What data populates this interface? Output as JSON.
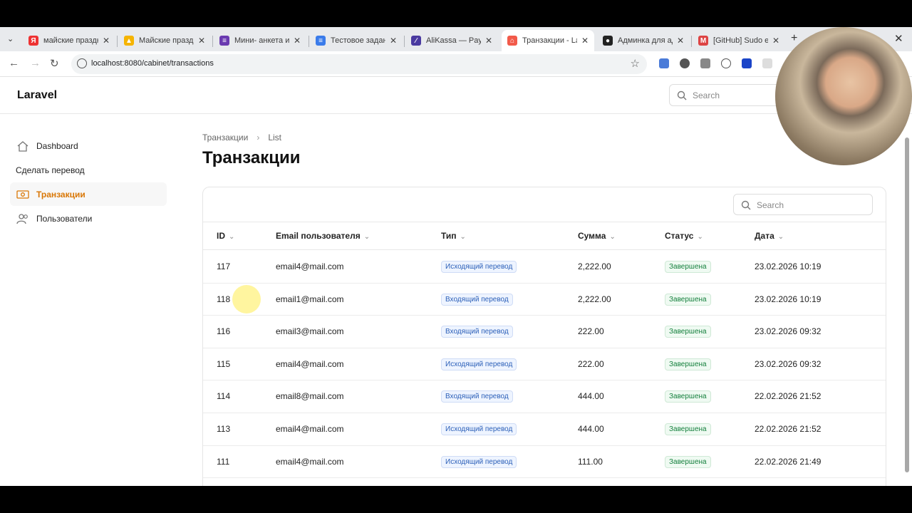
{
  "tabs": [
    {
      "title": "майские праздни",
      "fav_color": "#e33",
      "fav_glyph": "Я",
      "active": false
    },
    {
      "title": "Майские праздни",
      "fav_color": "#f5b400",
      "fav_glyph": "▲",
      "active": false
    },
    {
      "title": "Мини- анкета и и",
      "fav_color": "#6a3ab0",
      "fav_glyph": "≡",
      "active": false
    },
    {
      "title": "Тестовое задание",
      "fav_color": "#3a7bea",
      "fav_glyph": "≡",
      "active": false
    },
    {
      "title": "AliKassa — Payme",
      "fav_color": "#4a3aa0",
      "fav_glyph": "∕",
      "active": false
    },
    {
      "title": "Транзакции - Lar",
      "fav_color": "#f25a4a",
      "fav_glyph": "⌂",
      "active": true
    },
    {
      "title": "Админка для адм",
      "fav_color": "#222",
      "fav_glyph": "●",
      "active": false
    },
    {
      "title": "[GitHub] Sudo em",
      "fav_color": "#d44",
      "fav_glyph": "M",
      "active": false
    }
  ],
  "address": {
    "url": "localhost:8080/cabinet/transactions"
  },
  "app": {
    "brand": "Laravel",
    "search_placeholder": "Search"
  },
  "sidebar": {
    "items": [
      {
        "label": "Dashboard",
        "icon": "home-icon"
      },
      {
        "label": "Сделать перевод",
        "icon": ""
      },
      {
        "label": "Транзакции",
        "icon": "money-icon",
        "active": true
      },
      {
        "label": "Пользователи",
        "icon": "users-icon"
      }
    ]
  },
  "page": {
    "breadcrumb": [
      "Транзакции",
      "List"
    ],
    "title": "Транзакции"
  },
  "table": {
    "search_placeholder": "Search",
    "columns": [
      "ID",
      "Email пользователя",
      "Тип",
      "Сумма",
      "Статус",
      "Дата"
    ],
    "rows": [
      {
        "id": "117",
        "email": "email4@mail.com",
        "type": "Исходящий перевод",
        "amount": "2,222.00",
        "status": "Завершена",
        "date": "23.02.2026 10:19"
      },
      {
        "id": "118",
        "email": "email1@mail.com",
        "type": "Входящий перевод",
        "amount": "2,222.00",
        "status": "Завершена",
        "date": "23.02.2026 10:19"
      },
      {
        "id": "116",
        "email": "email3@mail.com",
        "type": "Входящий перевод",
        "amount": "222.00",
        "status": "Завершена",
        "date": "23.02.2026 09:32"
      },
      {
        "id": "115",
        "email": "email4@mail.com",
        "type": "Исходящий перевод",
        "amount": "222.00",
        "status": "Завершена",
        "date": "23.02.2026 09:32"
      },
      {
        "id": "114",
        "email": "email8@mail.com",
        "type": "Входящий перевод",
        "amount": "444.00",
        "status": "Завершена",
        "date": "22.02.2026 21:52"
      },
      {
        "id": "113",
        "email": "email4@mail.com",
        "type": "Исходящий перевод",
        "amount": "444.00",
        "status": "Завершена",
        "date": "22.02.2026 21:52"
      },
      {
        "id": "111",
        "email": "email4@mail.com",
        "type": "Исходящий перевод",
        "amount": "111.00",
        "status": "Завершена",
        "date": "22.02.2026 21:49"
      }
    ]
  },
  "colors": {
    "accent": "#d97706",
    "type_badge": "#2b5fb8",
    "status_badge": "#15803d"
  }
}
